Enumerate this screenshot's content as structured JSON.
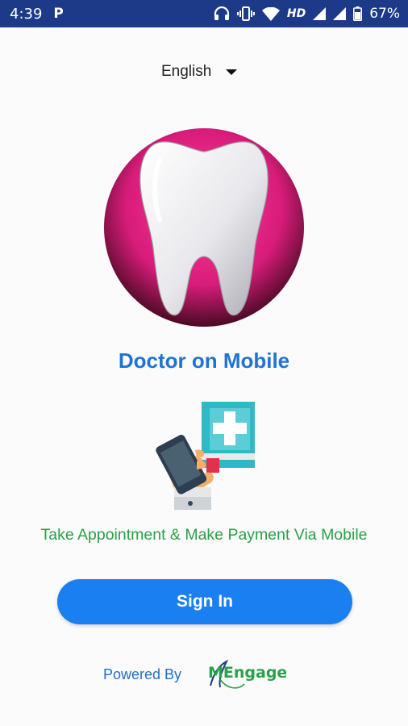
{
  "status_bar": {
    "time": "4:39",
    "notification": "P",
    "network_label": "HD",
    "battery": "67%"
  },
  "language": {
    "selected": "English"
  },
  "app": {
    "title": "Doctor on Mobile",
    "tagline": "Take Appointment & Make Payment Via Mobile"
  },
  "signin": {
    "label": "Sign In"
  },
  "footer": {
    "powered_by": "Powered By",
    "brand": "MEngage"
  },
  "colors": {
    "status_bar": "#1c3a87",
    "accent_blue": "#1a7ff0",
    "title_blue": "#1e74d6",
    "tagline_green": "#2aa04a",
    "logo_magenta": "#d81c7a"
  },
  "icons": [
    "headphones-icon",
    "vibrate-icon",
    "wifi-icon",
    "signal-icon",
    "battery-icon",
    "tooth-logo",
    "mobile-medical-illustration",
    "dropdown-arrow-icon"
  ]
}
